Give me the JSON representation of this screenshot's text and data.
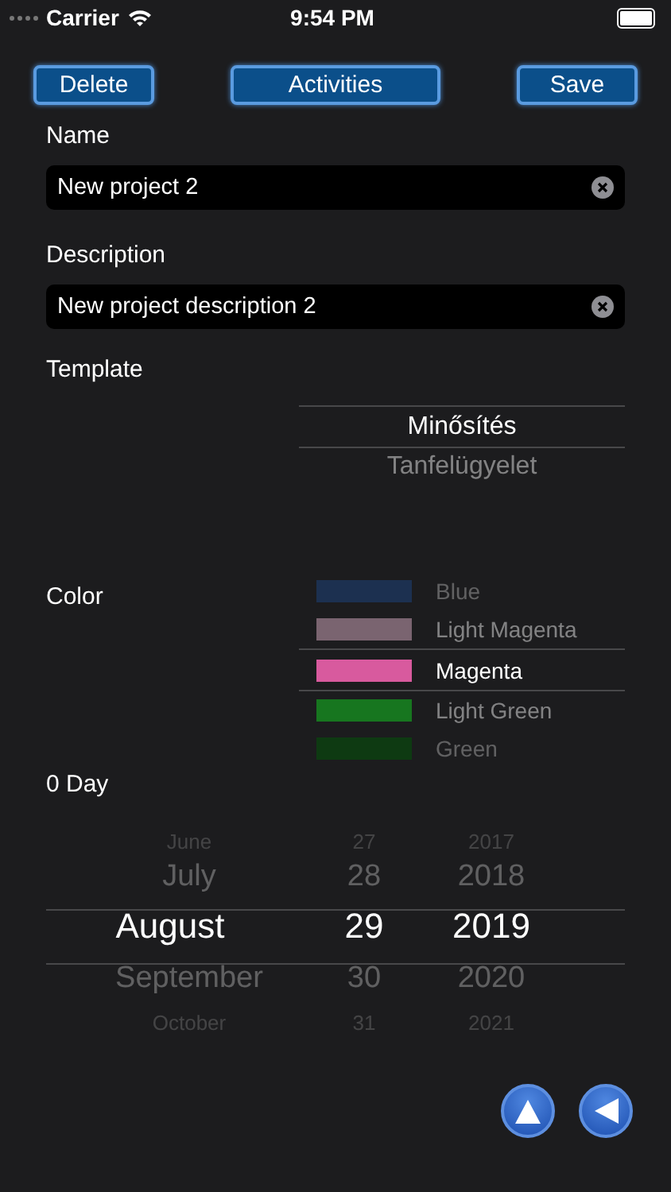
{
  "status_bar": {
    "carrier": "Carrier",
    "time": "9:54 PM"
  },
  "toolbar": {
    "buttons": [
      "Delete",
      "Activities",
      "Save"
    ]
  },
  "fields": [
    {
      "label": "Name",
      "value": "New project 2"
    },
    {
      "label": "Description",
      "value": "New project description 2"
    }
  ],
  "template": {
    "label": "Template",
    "options": [
      {
        "text": "Minősítés",
        "selected": true
      },
      {
        "text": "Tanfelügyelet",
        "selected": false
      }
    ]
  },
  "color": {
    "label": "Color",
    "options": [
      {
        "text": "Blue",
        "color": "#1c3050",
        "selected": false
      },
      {
        "text": "Light Magenta",
        "color": "#7a6470",
        "selected": false
      },
      {
        "text": "Magenta",
        "color": "#d85a9e",
        "selected": true
      },
      {
        "text": "Light Green",
        "color": "#17761f",
        "selected": false
      },
      {
        "text": "Green",
        "color": "#0e3a12",
        "selected": false
      }
    ]
  },
  "duration": {
    "label": "0 Day"
  },
  "date_picker": {
    "columns": [
      [
        {
          "text": "June",
          "selected": false
        },
        {
          "text": "July",
          "selected": false
        },
        {
          "text": "August",
          "selected": true
        },
        {
          "text": "September",
          "selected": false
        },
        {
          "text": "October",
          "selected": false
        }
      ],
      [
        {
          "text": "27",
          "selected": false
        },
        {
          "text": "28",
          "selected": false
        },
        {
          "text": "29",
          "selected": true
        },
        {
          "text": "30",
          "selected": false
        },
        {
          "text": "31",
          "selected": false
        }
      ],
      [
        {
          "text": "2017",
          "selected": false
        },
        {
          "text": "2018",
          "selected": false
        },
        {
          "text": "2019",
          "selected": true
        },
        {
          "text": "2020",
          "selected": false
        },
        {
          "text": "2021",
          "selected": false
        }
      ]
    ]
  }
}
